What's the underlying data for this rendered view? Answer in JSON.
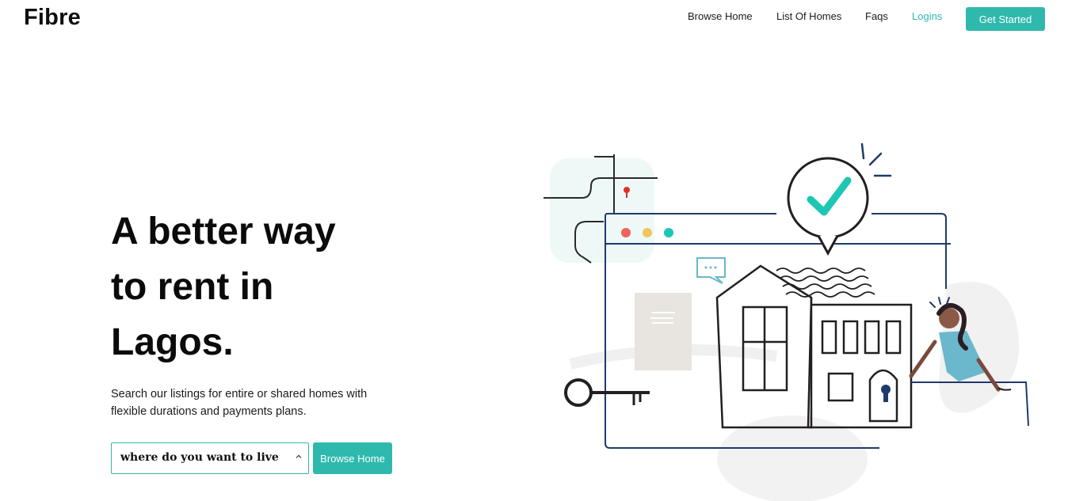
{
  "brand": {
    "name": "Fibre"
  },
  "nav": {
    "items": [
      {
        "label": "Browse Home",
        "active": false
      },
      {
        "label": "List Of Homes",
        "active": false
      },
      {
        "label": "Faqs",
        "active": false
      },
      {
        "label": "Logins",
        "active": true
      }
    ],
    "cta_label": "Get Started"
  },
  "hero": {
    "title_lines": [
      "A better way",
      "to rent in",
      "Lagos."
    ],
    "subtitle": "Search our listings for entire or shared homes with flexible durations and payments plans.",
    "location_select": {
      "selected": "where do you want to live",
      "icon": "chevron-up-icon"
    },
    "search_button": "Browse Home"
  },
  "illustration": {
    "subject": "house-rental-illustration"
  },
  "colors": {
    "accent": "#2fb9ad",
    "text": "#111111",
    "illustration_navy": "#1f3a6b",
    "dot_red": "#f0625b",
    "dot_yellow": "#f2c55c",
    "dot_teal": "#1cc7b4"
  }
}
